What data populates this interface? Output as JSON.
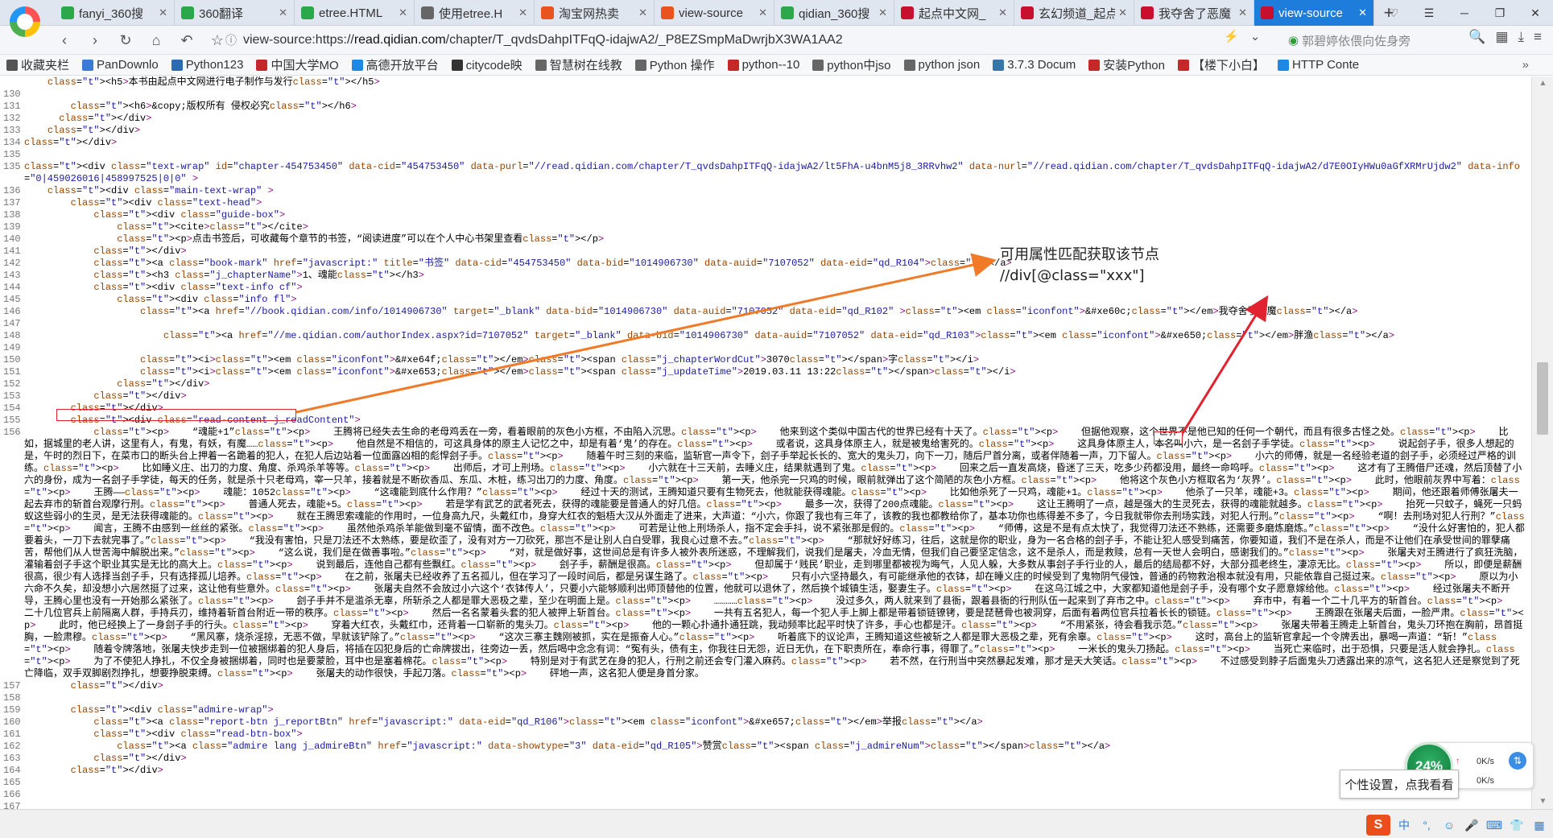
{
  "tabs": [
    {
      "label": "fanyi_360搜",
      "color": "#2aa84a",
      "active": false
    },
    {
      "label": "360翻译",
      "color": "#2aa84a",
      "active": false
    },
    {
      "label": "etree.HTML",
      "color": "#2aa84a",
      "active": false
    },
    {
      "label": "使用etree.H",
      "color": "#666666",
      "active": false
    },
    {
      "label": "淘宝网热卖",
      "color": "#e8531e",
      "active": false
    },
    {
      "label": "view-source",
      "color": "#e8531e",
      "active": false
    },
    {
      "label": "qidian_360搜",
      "color": "#2aa84a",
      "active": false
    },
    {
      "label": "起点中文网_",
      "color": "#c8102e",
      "active": false
    },
    {
      "label": "玄幻频道_起点",
      "color": "#c8102e",
      "active": false
    },
    {
      "label": "我夺舍了恶魔",
      "color": "#c8102e",
      "active": false
    },
    {
      "label": "view-source",
      "color": "#c8102e",
      "active": true
    }
  ],
  "address": {
    "prefix": "view-source:https://",
    "host": "read.qidian.com",
    "path": "/chapter/T_qvdsDahpITFqQ-idajwA2/_P8EZSmpMaDwrjbX3WA1AA2",
    "suggestion": "郭碧婷依偎向佐身旁"
  },
  "bookmarks": [
    {
      "label": "收藏夹栏",
      "color": "#555555"
    },
    {
      "label": "PanDownlo",
      "color": "#3a7bd5"
    },
    {
      "label": "Python123",
      "color": "#2b6cb0"
    },
    {
      "label": "中国大学MO",
      "color": "#c62828"
    },
    {
      "label": "高德开放平台",
      "color": "#1e88e5"
    },
    {
      "label": "citycode映",
      "color": "#333333"
    },
    {
      "label": "智慧树在线教",
      "color": "#666666"
    },
    {
      "label": "Python 操作",
      "color": "#666666"
    },
    {
      "label": "python--10",
      "color": "#c62828"
    },
    {
      "label": "python中jso",
      "color": "#666666"
    },
    {
      "label": "python json",
      "color": "#666666"
    },
    {
      "label": "3.7.3 Docum",
      "color": "#3776ab"
    },
    {
      "label": "安装Python",
      "color": "#c62828"
    },
    {
      "label": "【楼下小白】",
      "color": "#c62828"
    },
    {
      "label": "HTTP Conte",
      "color": "#1e88e5"
    }
  ],
  "source_lines": [
    {
      "n": "",
      "text": "    <h5>本书由起点中文网进行电子制作与发行</h5>"
    },
    {
      "n": "130",
      "text": ""
    },
    {
      "n": "131",
      "text": "        <h6>&copy;版权所有 侵权必究</h6>"
    },
    {
      "n": "132",
      "text": "      </div>"
    },
    {
      "n": "133",
      "text": "    </div>"
    },
    {
      "n": "134",
      "text": "</div>"
    },
    {
      "n": "135",
      "text": ""
    },
    {
      "n": "135",
      "text": "<div class=\"text-wrap\" id=\"chapter-454753450\" data-cid=\"454753450\" data-purl=\"//read.qidian.com/chapter/T_qvdsDahpITFqQ-idajwA2/lt5FhA-u4bnM5j8_3RRvhw2\" data-nurl=\"//read.qidian.com/chapter/T_qvdsDahpITFqQ-idajwA2/d7E0OIyHWu0aGfXRMrUjdw2\" data-info=\"0|459026016|458997525|0|0\" >"
    },
    {
      "n": "136",
      "text": "    <div class=\"main-text-wrap\" >"
    },
    {
      "n": "137",
      "text": "        <div class=\"text-head\">"
    },
    {
      "n": "138",
      "text": "            <div class=\"guide-box\">"
    },
    {
      "n": "139",
      "text": "                <cite></cite>"
    },
    {
      "n": "140",
      "text": "                <p>点击书签后，可收藏每个章节的书签，“阅读进度”可以在个人中心书架里查看</p>"
    },
    {
      "n": "141",
      "text": "            </div>"
    },
    {
      "n": "142",
      "text": "            <a class=\"book-mark\" href=\"javascript:\" title=\"书签\" data-cid=\"454753450\" data-bid=\"1014906730\" data-auid=\"7107052\" data-eid=\"qd_R104\"></a>"
    },
    {
      "n": "143",
      "text": "            <h3 class=\"j_chapterName\">1、魂能</h3>"
    },
    {
      "n": "144",
      "text": "            <div class=\"text-info cf\">"
    },
    {
      "n": "145",
      "text": "                <div class=\"info fl\">"
    },
    {
      "n": "146",
      "text": "                    <a href=\"//book.qidian.com/info/1014906730\" target=\"_blank\" data-bid=\"1014906730\" data-auid=\"7107052\" data-eid=\"qd_R102\" ><em class=\"iconfont\">&#xe60c;</em>我夺舍了恶魔</a>"
    },
    {
      "n": "147",
      "text": ""
    },
    {
      "n": "148",
      "text": "                        <a href=\"//me.qidian.com/authorIndex.aspx?id=7107052\" target=\"_blank\" data-bid=\"1014906730\" data-auid=\"7107052\" data-eid=\"qd_R103\"><em class=\"iconfont\">&#xe650;</em>胖渔</a>"
    },
    {
      "n": "149",
      "text": ""
    },
    {
      "n": "150",
      "text": "                    <i><em class=\"iconfont\">&#xe64f;</em><span class=\"j_chapterWordCut\">3070</span>字</i>"
    },
    {
      "n": "151",
      "text": "                    <i><em class=\"iconfont\">&#xe653;</em><span class=\"j_updateTime\">2019.03.11 13:22</span></i>"
    },
    {
      "n": "152",
      "text": "                </div>"
    },
    {
      "n": "153",
      "text": "            </div>"
    },
    {
      "n": "154",
      "text": "        </div>"
    },
    {
      "n": "155",
      "text": "        <div class=\"read-content j_readContent\">"
    },
    {
      "n": "156",
      "text": "            <p>    “魂能+1”<p>    王腾将已经失去生命的老母鸡丢在一旁，看着眼前的灰色小方框，不由陷入沉思。<p>    他来到这个类似中国古代的世界已经有十天了。<p>    但据他观察，这个世界不是他已知的任何一个朝代，而且有很多古怪之处。<p>    比如，据城里的老人讲，这里有人，有鬼，有妖，有魔……<p>    他自然是不相信的，可这具身体的原主人记忆之中，却是有着‘鬼’的存在。<p>    或者说，这具身体原主人，就是被鬼给害死的。<p>    这具身体原主人，本名叫小六，是一名刽子手学徒。<p>    说起刽子手，很多人想起的是，午时的烈日下，在菜市口的断头台上押着一名跪着的犯人，在犯人后边站着一位面露凶相的彪悍刽子手。<p>    随着午时三刻的来临，监斩官一声令下，刽子手举起长长的、宽大的鬼头刀，向下一刀，随后尸首分离，或者伴随着一声，刀下留人。<p>    小六的师傅，就是一名经验老道的刽子手，必须经过严格的训练。<p>    比如睡义庄、出刀的力度、角度、杀鸡杀羊等等。<p>    出师后，才可上刑场。<p>    小六就在十三天前，去睡义庄，结果就遇到了鬼。<p>    回来之后一直发高烧，昏迷了三天，吃多少药都没用，最终一命呜呼。<p>    这才有了王腾借尸还魂，然后顶替了小六的身份，成为一名刽子手学徒，每天的任务，就是杀十只老母鸡，宰一只羊，接着就是不断砍香瓜、东瓜、木桩，练习出刀的力度、角度。<p>    第一天，他杀完一只鸡的时候，眼前就弹出了这个简陋的灰色小方框。<p>    他将这个灰色小方框取名为‘灰界’。<p>    此时，他眼前灰界中写着：<p>    王腾——<p>    魂能：1052<p>    “这魂能到底什么作用？”<p>    经过十天的测试，王腾知道只要有生物死去，他就能获得魂能。<p>    比如他杀死了一只鸡，魂能+1。<p>    他杀了一只羊，魂能+3。<p>    期间，他还跟着师傅张屠夫一起去弃市的斩首台观摩行刑。<p>    普通人死去，魂能+5。<p>    若是学有武艺的武者死去，获得的魂能要是普通人的好几倍。<p>    最多一次，获得了200点魂能。<p>    这让王腾明了一点，越是强大的生灵死去，获得的魂能就越多。<p>    抬死一只蚊子，蝇死一只蚂蚁这些弱小的生灵，是无法获得魂能的。<p>    就在王腾思索魂能的作用时，一位身高九尺，头戴红巾，身穿大红衣的魁梧大汉从外面走了进来，大声道：“小六，你跟了我也有三年了，该教的我也都教给你了，基本功你也练得差不多了，今日我就带你去刑场实践，对犯人行刑。”<p>    “啊！去刑场对犯人行刑？”<p>    闻言，王腾不由感到一丝丝的紧张。<p>    虽然他杀鸡杀羊能做到毫不留情，面不改色。<p>    可若是让他上刑场杀人，指不定会手抖，说不紧张那是假的。<p>    “师傅，这是不是有点太快了，我觉得刀法还不熟练，还需要多磨炼磨炼。”<p>    “没什么好害怕的，犯人都要着头，一刀下去就完事了。”<p>    “我没有害怕，只是刀法还不太熟练，要是砍歪了，没有对方一刀砍死，那岂不是让别人白白受罪，我良心过意不去。”<p>    “那就好好练习，往后，这就是你的职业，身为一名合格的刽子手，不能让犯人感受到痛苦，你要知道，我们不是在杀人，而是不让他们在承受世间的罪孽痛苦，帮他们从人世苦海中解脱出来。”<p>    “这么说，我们是在做善事啦。”<p>    “对，就是做好事，这世间总是有许多人被外表所迷惑，不理解我们，说我们是屠夫，冷血无情，但我们自己要坚定信念，这不是杀人，而是救赎，总有一天世人会明白，感谢我们的。”<p>    张屠夫对王腾进行了疯狂洗脑，灌输着刽子手这个职业其实是无比的高大上。<p>    说到最后，连他自己都有些飘红。<p>    刽子手，薪酬是很高。<p>    但却属于‘贱民’职业，走到哪里都被视为晦气，人见人躲，大多数从事刽子手行业的人，最后的结局都不好，大部分孤老终生，凄凉无比。<p>    所以，即便是薪酬很高，很少有人选择当刽子手，只有选择孤儿培养。<p>    在之前，张屠夫已经收养了五名孤儿，但在学习了一段时间后，都是另谋生路了。<p>    只有小六坚持最久，有可能继承他的衣钵，却在睡义庄的时候受到了鬼物阴气侵蚀，普通的药物救治根本就没有用，只能依靠自己挺过来。<p>    原以为小六命不久矣，却没想小六居然挺了过来，这让他有些意外。<p>    张屠夫自然不会放过小六这个‘衣钵传人’，只要小六能够顺利出师顶替他的位置，他就可以退休了，然后换个城镇生活，娶妻生子。<p>    在这乌江城之中，大家都知道他是刽子手，没有哪个女子愿意嫁给他。<p>    经过张屠夫不断开导，王腾心里也没有一开始那么紧张了。<p>    刽子手并不是滥杀无辜，所斩杀之人都是罪大恶极之辈，至少在明面上是。<p>    …………<p>    没过多久，两人就来到了县衙，跟着县衙的行刑队伍一起来到了弃市之中。<p>    弃市中，有着一个二十几平方的斩首台。<p>    二十几位官兵上前隔离人群，手持兵刃，维持着斩首台附近一带的秩序。<p>    然后一名名蒙着头套的犯人被押上斩首台。<p>    一共有五名犯人，每一个犯人手上脚上都是带着锁链镣铐，要是琵琶骨也被洞穿，后面有着两位官兵拉着长长的锁链。<p>    王腾跟在张屠夫后面，一脸严肃。<p>    此时，他已经换上了一身刽子手的行头。<p>    穿着大红衣，头戴红巾，还背着一口崭新的鬼头刀。<p>    他的一颗心扑通扑通狂跳，我动频率比起平时快了许多，手心也都是汗。<p>    “不用紧张，待会看我示范。”<p>    张屠夫带着王腾走上斩首台，鬼头刀环抱在胸前，昂首挺胸，一脸肃穆。<p>    “黑风寨，烧杀淫掠，无恶不做，早就该铲除了。”<p>    “这次三寨主魏刚被抓，实在是振奋人心。”<p>    听着底下的议论声，王腾知道这些被斩之人都是罪大恶极之辈，死有余辜。<p>    这时，高台上的监斩官拿起一个令牌丢出，暴喝一声道：“斩！”<p>    随着令牌落地，张屠夫快步走到一位被捆绑着的犯人身后，将插在囚犯身后的亡命牌拔出，往旁边一丢，然后喝中念念有词：“冤有头，债有主，你我往日无怨，近日无仇，在下职责所在，奉命行事，得罪了。”<p>    一米长的鬼头刀扬起。<p>    当死亡来临时，出于恐惧，只要是活人就会挣扎。<p>    为了不使犯人挣扎，不仅全身被捆绑着，同时也是要蒙脸，耳中也是塞着棉花。<p>    特别是对于有武艺在身的犯人，行刑之前还会专门灌入麻药。<p>    若不然，在行刑当中突然暴起发难，那才是天大笑话。<p>    不过感受到脖子后面鬼头刀透露出来的凉气，这名犯人还是察觉到了死亡降临，双手双脚剧烈挣扎，想要挣脱束缚。<p>    张屠夫的动作很快，手起刀落。<p>    砰地一声，这名犯人便是身首分家。"
    },
    {
      "n": "157",
      "text": "        </div>"
    },
    {
      "n": "158",
      "text": ""
    },
    {
      "n": "159",
      "text": "        <div class=\"admire-wrap\">"
    },
    {
      "n": "160",
      "text": "            <a class=\"report-btn j_reportBtn\" href=\"javascript:\" data-eid=\"qd_R106\"><em class=\"iconfont\">&#xe657;</em>举报</a>"
    },
    {
      "n": "161",
      "text": "            <div class=\"read-btn-box\">"
    },
    {
      "n": "162",
      "text": "                <a class=\"admire lang j_admireBtn\" href=\"javascript:\" data-showtype=\"3\" data-eid=\"qd_R105\">赞赏<span class=\"j_admireNum\"></span></a>"
    },
    {
      "n": "163",
      "text": "            </div>"
    },
    {
      "n": "164",
      "text": "        </div>"
    },
    {
      "n": "165",
      "text": ""
    },
    {
      "n": "166",
      "text": ""
    },
    {
      "n": "167",
      "text": ""
    }
  ],
  "annotation": {
    "line1": "可用属性匹配获取该节点",
    "line2": "//div[@class=\"xxx\"]",
    "color": "#e0232f",
    "arrow_color": "#f07a28"
  },
  "network": {
    "percent": "24%",
    "up": "0K/s",
    "down": "0K/s"
  },
  "tooltip": "个性设置，点我看看"
}
